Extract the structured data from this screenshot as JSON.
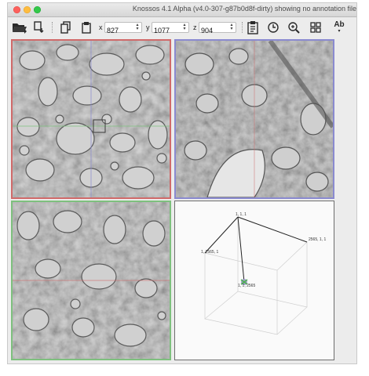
{
  "window": {
    "title": "Knossos 4.1 Alpha (v4.0-307-g87b0d8f-dirty) showing no annotation file"
  },
  "toolbar": {
    "icons": [
      "folder-open-icon",
      "save-icon",
      "copy-icon",
      "paste-icon",
      "task-icon",
      "clock-icon",
      "zoom-icon",
      "grid-icon",
      "text-ab-icon"
    ],
    "coords": {
      "x_label": "x",
      "x_value": "827",
      "y_label": "y",
      "y_value": "1077",
      "z_label": "z",
      "z_value": "904"
    },
    "ab_label": "Ab"
  },
  "viewports": {
    "vp3d": {
      "labels": {
        "top": "1, 1, 1",
        "right": "2565, 1, 1",
        "left": "1, 2565, 1",
        "center": "1, 1, 2565"
      }
    }
  },
  "colors": {
    "xy_border": "#d06a6a",
    "xz_border": "#8a8ad0",
    "zy_border": "#7ec07e"
  }
}
